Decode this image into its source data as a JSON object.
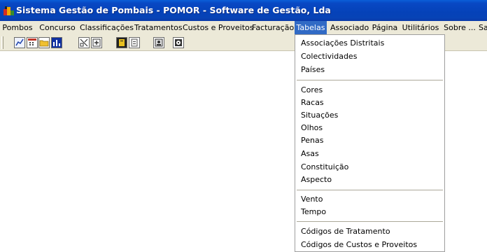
{
  "window": {
    "title": "Sistema Gestão de Pombais - POMOR - Software de Gestão, Lda",
    "colors": {
      "titlebar": "#0542b8",
      "menubar": "#ece9d8",
      "highlight": "#316ac5"
    }
  },
  "menubar": {
    "items": [
      {
        "label": "Pombos"
      },
      {
        "label": "Concurso"
      },
      {
        "label": "Classificações"
      },
      {
        "label": "Tratamentos"
      },
      {
        "label": "Custos e Proveitos"
      },
      {
        "label": "Facturação"
      },
      {
        "label": "Tabelas",
        "active": true
      },
      {
        "label": "Associado"
      },
      {
        "label": "Página"
      },
      {
        "label": "Utilitários"
      },
      {
        "label": "Sobre ..."
      },
      {
        "label": "Sa"
      }
    ]
  },
  "toolbar": {
    "buttons": [
      {
        "icon": "chart-line-icon"
      },
      {
        "icon": "calendar-icon"
      },
      {
        "icon": "folder-icon"
      },
      {
        "icon": "bar-chart-icon"
      },
      {
        "icon": "printer-icon"
      },
      {
        "icon": "add-record-icon"
      },
      {
        "icon": "book-icon"
      },
      {
        "icon": "document-icon"
      },
      {
        "icon": "form-icon"
      },
      {
        "icon": "exit-icon"
      }
    ]
  },
  "tabelas_menu": {
    "groups": [
      [
        "Associações Distritais",
        "Colectividades",
        "Países"
      ],
      [
        "Cores",
        "Racas",
        "Situações",
        "Olhos",
        "Penas",
        "Asas",
        "Constituição",
        "Aspecto"
      ],
      [
        "Vento",
        "Tempo"
      ],
      [
        "Códigos de Tratamento",
        "Códigos de Custos e Proveitos"
      ]
    ]
  }
}
